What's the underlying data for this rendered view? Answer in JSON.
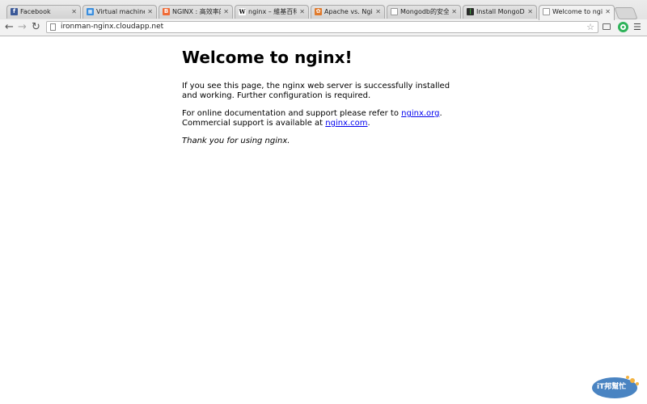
{
  "tabs": [
    {
      "title": "Facebook",
      "icon": "facebook-icon",
      "color": "#3b5998",
      "glyph": "f"
    },
    {
      "title": "Virtual machines - ",
      "icon": "windows-icon",
      "color": "#3a8ede",
      "glyph": "▦"
    },
    {
      "title": "NGINX : 高效率的 W",
      "icon": "blogger-icon",
      "color": "#f06a35",
      "glyph": "B"
    },
    {
      "title": "nginx – 維基百科，",
      "icon": "wikipedia-icon",
      "color": "#ffffff",
      "glyph": "W"
    },
    {
      "title": "Apache vs. Nginx ",
      "icon": "apache-icon",
      "color": "#e07a2c",
      "glyph": "✿"
    },
    {
      "title": "Mongodb的安全性",
      "icon": "page-icon",
      "color": "#ffffff",
      "glyph": ""
    },
    {
      "title": "Install MongoDB o",
      "icon": "mongodb-icon",
      "color": "#3f9b3f",
      "glyph": "❙"
    },
    {
      "title": "Welcome to nginx!",
      "icon": "page-icon",
      "color": "#ffffff",
      "glyph": ""
    }
  ],
  "omnibox": {
    "url": "ironman-nginx.cloudapp.net"
  },
  "page": {
    "heading": "Welcome to nginx!",
    "para1": "If you see this page, the nginx web server is successfully installed and working. Further configuration is required.",
    "para2_prefix": "For online documentation and support please refer to ",
    "link1": "nginx.org",
    "para2_mid": "Commercial support is available at ",
    "link2": "nginx.com",
    "thanks": "Thank you for using nginx."
  },
  "watermark": {
    "text": "iT邦幫忙"
  }
}
